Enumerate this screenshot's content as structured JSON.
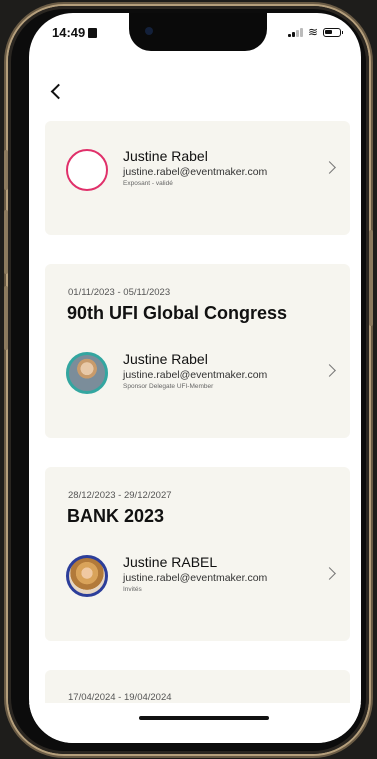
{
  "status_bar": {
    "time": "14:49"
  },
  "cards": [
    {
      "dates": "",
      "title": "",
      "person": {
        "name": "Justine Rabel",
        "email": "justine.rabel@eventmaker.com",
        "role": "Exposant - validé",
        "avatar_style": "empty-pink-ring"
      }
    },
    {
      "dates": "01/11/2023 - 05/11/2023",
      "title": "90th UFI Global Congress",
      "person": {
        "name": "Justine Rabel",
        "email": "justine.rabel@eventmaker.com",
        "role": "Sponsor Delegate UFI-Member",
        "avatar_style": "photo-teal-ring"
      }
    },
    {
      "dates": "28/12/2023 - 29/12/2027",
      "title": "BANK 2023",
      "person": {
        "name": "Justine RABEL",
        "email": "justine.rabel@eventmaker.com",
        "role": "Invités",
        "avatar_style": "photo-navy-ring"
      }
    },
    {
      "dates": "17/04/2024 - 19/04/2024",
      "title": "",
      "person": null
    }
  ],
  "colors": {
    "card_bg": "#f6f5ef",
    "accent_pink": "#e0306a",
    "accent_teal": "#33a6a0",
    "accent_navy": "#2c3e9a"
  }
}
